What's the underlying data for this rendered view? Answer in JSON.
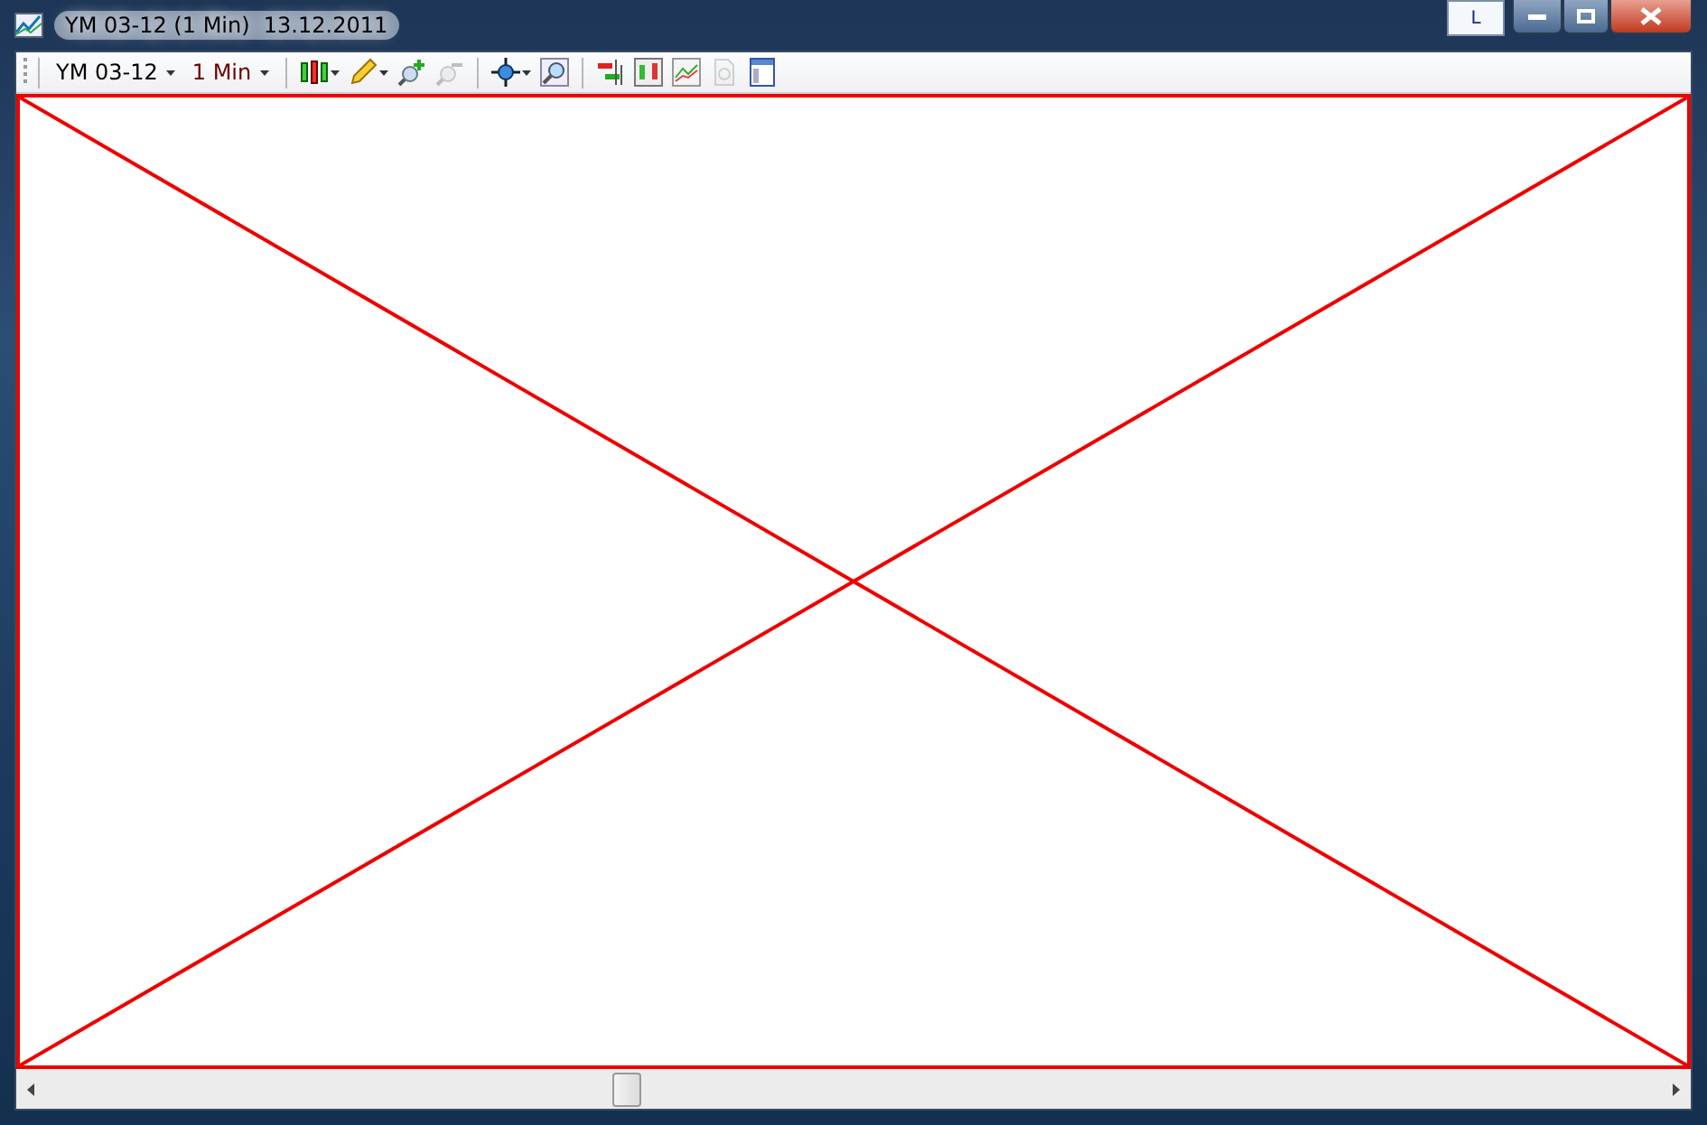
{
  "window": {
    "title": "YM 03-12 (1 Min)  13.12.2011",
    "language_indicator": "L"
  },
  "toolbar": {
    "instrument": "YM 03-12",
    "interval": "1 Min",
    "tool_groups": [
      [
        {
          "kind": "candles",
          "disabled": false,
          "dropdown": true
        },
        {
          "kind": "pencil",
          "disabled": false,
          "dropdown": true
        },
        {
          "kind": "zoom-in",
          "disabled": false
        },
        {
          "kind": "zoom-out",
          "disabled": true
        }
      ],
      [
        {
          "kind": "crosshair",
          "disabled": false,
          "dropdown": true
        },
        {
          "kind": "magnifier",
          "disabled": false
        }
      ],
      [
        {
          "kind": "strategy",
          "disabled": false
        },
        {
          "kind": "bars",
          "disabled": false
        },
        {
          "kind": "line-chart",
          "disabled": false
        },
        {
          "kind": "dollar-doc",
          "disabled": true
        },
        {
          "kind": "panel",
          "disabled": false
        }
      ]
    ]
  },
  "scrollbar": {
    "level": 0.36
  }
}
